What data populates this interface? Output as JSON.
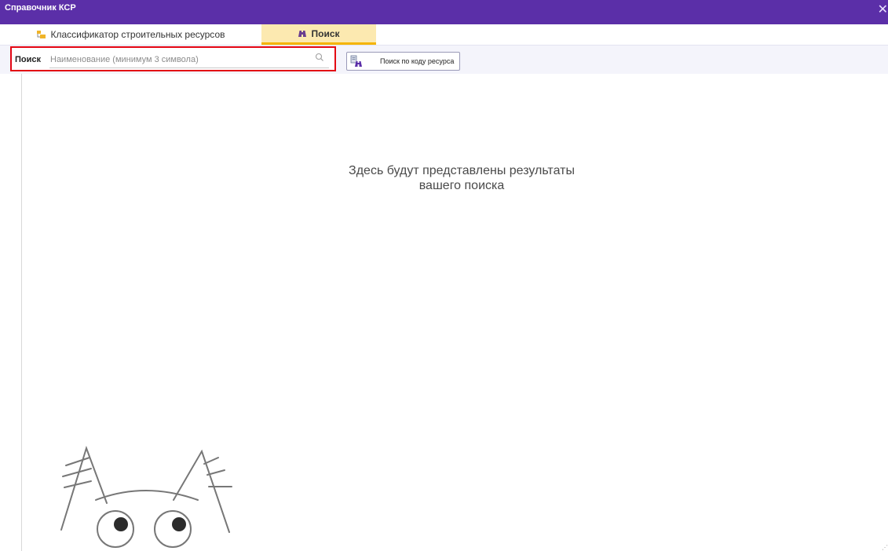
{
  "window": {
    "title": "Справочник КСР",
    "close_glyph": "✕"
  },
  "tabs": [
    {
      "label": "Классификатор строительных ресурсов",
      "icon": "folder-tree-icon",
      "active": false
    },
    {
      "label": "Поиск",
      "icon": "binoculars-icon",
      "active": true
    }
  ],
  "search": {
    "label": "Поиск",
    "placeholder": "Наименование (минимум 3 символа)",
    "value": "",
    "icon": "search-icon"
  },
  "code_search_button": {
    "label": "Поиск по коду ресурса",
    "icon": "code-binoculars-icon"
  },
  "results": {
    "empty_line1": "Здесь будут представлены результаты",
    "empty_line2": "вашего поиска"
  },
  "colors": {
    "titlebar": "#5b2fa8",
    "active_tab": "#fce9b0",
    "active_tab_underline": "#f5b400",
    "highlight_frame": "#e30613"
  }
}
